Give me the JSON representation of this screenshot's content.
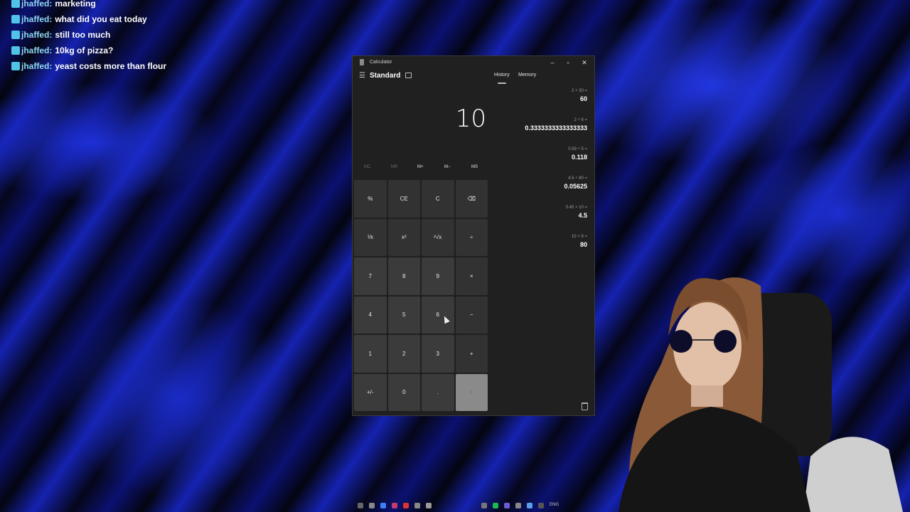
{
  "chat": [
    {
      "user": "jhaffed:",
      "message": "marketing"
    },
    {
      "user": "jhaffed:",
      "message": "what did you eat today"
    },
    {
      "user": "jhaffed:",
      "message": "still too much"
    },
    {
      "user": "jhaffed:",
      "message": "10kg of pizza?"
    },
    {
      "user": "jhaffed:",
      "message": "yeast costs more than flour"
    }
  ],
  "calculator": {
    "window_title": "Calculator",
    "mode": "Standard",
    "tabs": {
      "history": "History",
      "memory": "Memory"
    },
    "display": "10",
    "memory_buttons": [
      "MC",
      "MR",
      "M+",
      "M−",
      "MS"
    ],
    "keys": [
      "%",
      "CE",
      "C",
      "⌫",
      "⅟x",
      "x²",
      "²√x",
      "÷",
      "7",
      "8",
      "9",
      "×",
      "4",
      "5",
      "6",
      "−",
      "1",
      "2",
      "3",
      "+",
      "+/-",
      "0",
      ".",
      "="
    ],
    "history": [
      {
        "expr": "2 × 30 =",
        "result": "60"
      },
      {
        "expr": "2 ÷ 6 =",
        "result": "0.3333333333333333"
      },
      {
        "expr": "0.59 ÷ 5 =",
        "result": "0.118"
      },
      {
        "expr": "4.5 ÷ 80 =",
        "result": "0.05625"
      },
      {
        "expr": "0.45 × 10 =",
        "result": "4.5"
      },
      {
        "expr": "10 × 8 =",
        "result": "80"
      }
    ]
  },
  "taskbar": {
    "language": "ENG"
  },
  "colors": {
    "accent_chat": "#4fc3e8",
    "calc_bg": "#202020",
    "key_bg": "#323232"
  }
}
